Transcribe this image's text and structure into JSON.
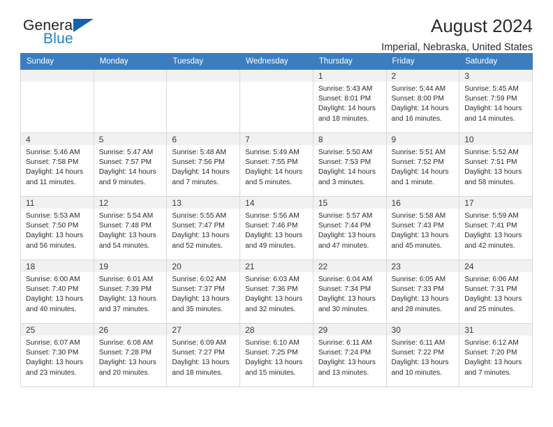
{
  "brand": {
    "word_top": "General",
    "word_bottom": "Blue",
    "triangle_icon": "triangle-icon",
    "accent_color": "#1f7fd0",
    "header_color": "#3a7ec0"
  },
  "header": {
    "title": "August 2024",
    "subtitle": "Imperial, Nebraska, United States"
  },
  "calendar": {
    "weekday_headers": [
      "Sunday",
      "Monday",
      "Tuesday",
      "Wednesday",
      "Thursday",
      "Friday",
      "Saturday"
    ],
    "labels": {
      "sunrise": "Sunrise:",
      "sunset": "Sunset:",
      "daylight": "Daylight:"
    },
    "weeks": [
      [
        {
          "day": "",
          "empty": true
        },
        {
          "day": "",
          "empty": true
        },
        {
          "day": "",
          "empty": true
        },
        {
          "day": "",
          "empty": true
        },
        {
          "day": "1",
          "sunrise": "Sunrise: 5:43 AM",
          "sunset": "Sunset: 8:01 PM",
          "daylight": "Daylight: 14 hours and 18 minutes."
        },
        {
          "day": "2",
          "sunrise": "Sunrise: 5:44 AM",
          "sunset": "Sunset: 8:00 PM",
          "daylight": "Daylight: 14 hours and 16 minutes."
        },
        {
          "day": "3",
          "sunrise": "Sunrise: 5:45 AM",
          "sunset": "Sunset: 7:59 PM",
          "daylight": "Daylight: 14 hours and 14 minutes."
        }
      ],
      [
        {
          "day": "4",
          "sunrise": "Sunrise: 5:46 AM",
          "sunset": "Sunset: 7:58 PM",
          "daylight": "Daylight: 14 hours and 11 minutes."
        },
        {
          "day": "5",
          "sunrise": "Sunrise: 5:47 AM",
          "sunset": "Sunset: 7:57 PM",
          "daylight": "Daylight: 14 hours and 9 minutes."
        },
        {
          "day": "6",
          "sunrise": "Sunrise: 5:48 AM",
          "sunset": "Sunset: 7:56 PM",
          "daylight": "Daylight: 14 hours and 7 minutes."
        },
        {
          "day": "7",
          "sunrise": "Sunrise: 5:49 AM",
          "sunset": "Sunset: 7:55 PM",
          "daylight": "Daylight: 14 hours and 5 minutes."
        },
        {
          "day": "8",
          "sunrise": "Sunrise: 5:50 AM",
          "sunset": "Sunset: 7:53 PM",
          "daylight": "Daylight: 14 hours and 3 minutes."
        },
        {
          "day": "9",
          "sunrise": "Sunrise: 5:51 AM",
          "sunset": "Sunset: 7:52 PM",
          "daylight": "Daylight: 14 hours and 1 minute."
        },
        {
          "day": "10",
          "sunrise": "Sunrise: 5:52 AM",
          "sunset": "Sunset: 7:51 PM",
          "daylight": "Daylight: 13 hours and 58 minutes."
        }
      ],
      [
        {
          "day": "11",
          "sunrise": "Sunrise: 5:53 AM",
          "sunset": "Sunset: 7:50 PM",
          "daylight": "Daylight: 13 hours and 56 minutes."
        },
        {
          "day": "12",
          "sunrise": "Sunrise: 5:54 AM",
          "sunset": "Sunset: 7:48 PM",
          "daylight": "Daylight: 13 hours and 54 minutes."
        },
        {
          "day": "13",
          "sunrise": "Sunrise: 5:55 AM",
          "sunset": "Sunset: 7:47 PM",
          "daylight": "Daylight: 13 hours and 52 minutes."
        },
        {
          "day": "14",
          "sunrise": "Sunrise: 5:56 AM",
          "sunset": "Sunset: 7:46 PM",
          "daylight": "Daylight: 13 hours and 49 minutes."
        },
        {
          "day": "15",
          "sunrise": "Sunrise: 5:57 AM",
          "sunset": "Sunset: 7:44 PM",
          "daylight": "Daylight: 13 hours and 47 minutes."
        },
        {
          "day": "16",
          "sunrise": "Sunrise: 5:58 AM",
          "sunset": "Sunset: 7:43 PM",
          "daylight": "Daylight: 13 hours and 45 minutes."
        },
        {
          "day": "17",
          "sunrise": "Sunrise: 5:59 AM",
          "sunset": "Sunset: 7:41 PM",
          "daylight": "Daylight: 13 hours and 42 minutes."
        }
      ],
      [
        {
          "day": "18",
          "sunrise": "Sunrise: 6:00 AM",
          "sunset": "Sunset: 7:40 PM",
          "daylight": "Daylight: 13 hours and 40 minutes."
        },
        {
          "day": "19",
          "sunrise": "Sunrise: 6:01 AM",
          "sunset": "Sunset: 7:39 PM",
          "daylight": "Daylight: 13 hours and 37 minutes."
        },
        {
          "day": "20",
          "sunrise": "Sunrise: 6:02 AM",
          "sunset": "Sunset: 7:37 PM",
          "daylight": "Daylight: 13 hours and 35 minutes."
        },
        {
          "day": "21",
          "sunrise": "Sunrise: 6:03 AM",
          "sunset": "Sunset: 7:36 PM",
          "daylight": "Daylight: 13 hours and 32 minutes."
        },
        {
          "day": "22",
          "sunrise": "Sunrise: 6:04 AM",
          "sunset": "Sunset: 7:34 PM",
          "daylight": "Daylight: 13 hours and 30 minutes."
        },
        {
          "day": "23",
          "sunrise": "Sunrise: 6:05 AM",
          "sunset": "Sunset: 7:33 PM",
          "daylight": "Daylight: 13 hours and 28 minutes."
        },
        {
          "day": "24",
          "sunrise": "Sunrise: 6:06 AM",
          "sunset": "Sunset: 7:31 PM",
          "daylight": "Daylight: 13 hours and 25 minutes."
        }
      ],
      [
        {
          "day": "25",
          "sunrise": "Sunrise: 6:07 AM",
          "sunset": "Sunset: 7:30 PM",
          "daylight": "Daylight: 13 hours and 23 minutes."
        },
        {
          "day": "26",
          "sunrise": "Sunrise: 6:08 AM",
          "sunset": "Sunset: 7:28 PM",
          "daylight": "Daylight: 13 hours and 20 minutes."
        },
        {
          "day": "27",
          "sunrise": "Sunrise: 6:09 AM",
          "sunset": "Sunset: 7:27 PM",
          "daylight": "Daylight: 13 hours and 18 minutes."
        },
        {
          "day": "28",
          "sunrise": "Sunrise: 6:10 AM",
          "sunset": "Sunset: 7:25 PM",
          "daylight": "Daylight: 13 hours and 15 minutes."
        },
        {
          "day": "29",
          "sunrise": "Sunrise: 6:11 AM",
          "sunset": "Sunset: 7:24 PM",
          "daylight": "Daylight: 13 hours and 13 minutes."
        },
        {
          "day": "30",
          "sunrise": "Sunrise: 6:11 AM",
          "sunset": "Sunset: 7:22 PM",
          "daylight": "Daylight: 13 hours and 10 minutes."
        },
        {
          "day": "31",
          "sunrise": "Sunrise: 6:12 AM",
          "sunset": "Sunset: 7:20 PM",
          "daylight": "Daylight: 13 hours and 7 minutes."
        }
      ]
    ]
  }
}
